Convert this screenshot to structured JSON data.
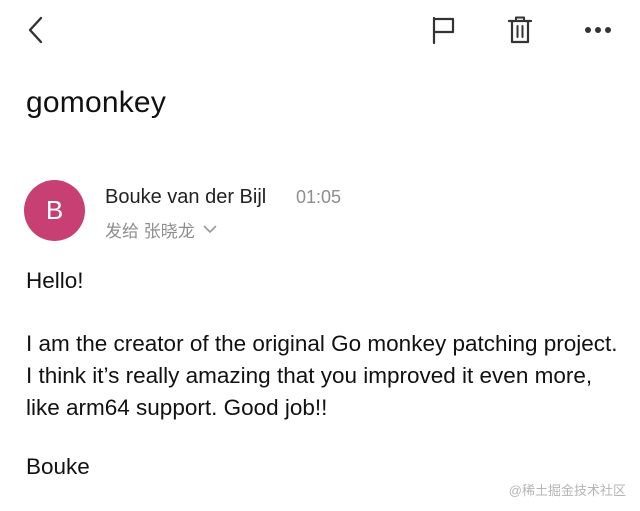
{
  "toolbar": {
    "back_icon": "chevron-left-icon",
    "flag_icon": "flag-icon",
    "trash_icon": "trash-icon",
    "more_icon": "more-horizontal-icon"
  },
  "email": {
    "subject": "gomonkey",
    "sender": {
      "avatar_initial": "B",
      "avatar_color": "#c73f73",
      "name": "Bouke van der Bijl",
      "time": "01:05",
      "recipient_line": "发给 张晓龙"
    },
    "body": {
      "greeting": "Hello!",
      "paragraph": "I am the creator of the original Go monkey patching project. I think it’s really amazing that you improved it even more, like arm64 support. Good job!!",
      "signoff": "Bouke"
    }
  },
  "watermark": "@稀土掘金技术社区"
}
